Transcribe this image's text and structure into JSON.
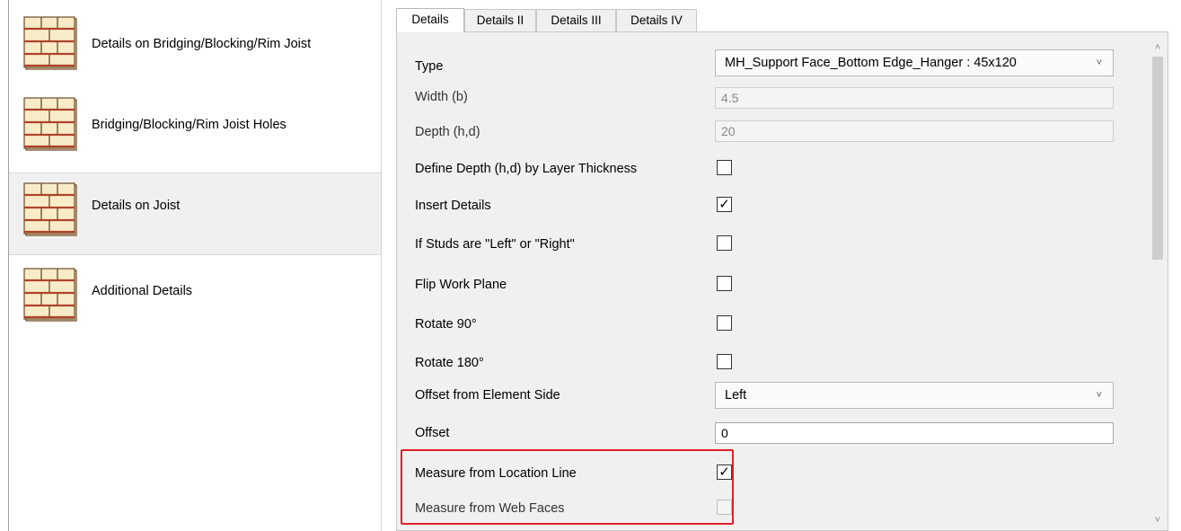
{
  "left_panel": {
    "items": [
      {
        "label": "Details on Bridging/Blocking/Rim Joist",
        "icon": "joist-detail-icon",
        "selected": false
      },
      {
        "label": "Bridging/Blocking/Rim Joist Holes",
        "icon": "joist-detail-icon",
        "selected": false
      },
      {
        "label": "Details on Joist",
        "icon": "joist-detail-icon",
        "selected": true
      },
      {
        "label": "Additional Details",
        "icon": "joist-detail-icon",
        "selected": false
      }
    ]
  },
  "tabs": [
    {
      "label": "Details",
      "active": true
    },
    {
      "label": "Details II",
      "active": false
    },
    {
      "label": "Details III",
      "active": false
    },
    {
      "label": "Details IV",
      "active": false
    }
  ],
  "properties": {
    "type": {
      "label": "Type",
      "value": "MH_Support Face_Bottom Edge_Hanger : 45x120"
    },
    "width": {
      "label": "Width (b)",
      "value": "4.5"
    },
    "depth": {
      "label": "Depth (h,d)",
      "value": "20"
    },
    "define_depth": {
      "label": "Define Depth (h,d) by Layer Thickness",
      "checked": false
    },
    "insert_details": {
      "label": "Insert Details",
      "checked": true
    },
    "studs_left_right": {
      "label": "If Studs are \"Left\" or \"Right\"",
      "checked": false
    },
    "flip_work_plane": {
      "label": "Flip Work Plane",
      "checked": false
    },
    "rotate_90": {
      "label": "Rotate 90°",
      "checked": false
    },
    "rotate_180": {
      "label": "Rotate 180°",
      "checked": false
    },
    "offset_side": {
      "label": "Offset from Element Side",
      "value": "Left"
    },
    "offset": {
      "label": "Offset",
      "value": "0"
    },
    "measure_location_line": {
      "label": "Measure from Location Line",
      "checked": true
    },
    "measure_web_faces": {
      "label": "Measure from Web Faces",
      "checked": false,
      "disabled": true
    }
  },
  "glyphs": {
    "check": "✓",
    "chevron_down": "˅",
    "chevron_up": "˄"
  },
  "colors": {
    "highlight": "#e0202a",
    "selected_bg": "#f0f0f0"
  }
}
